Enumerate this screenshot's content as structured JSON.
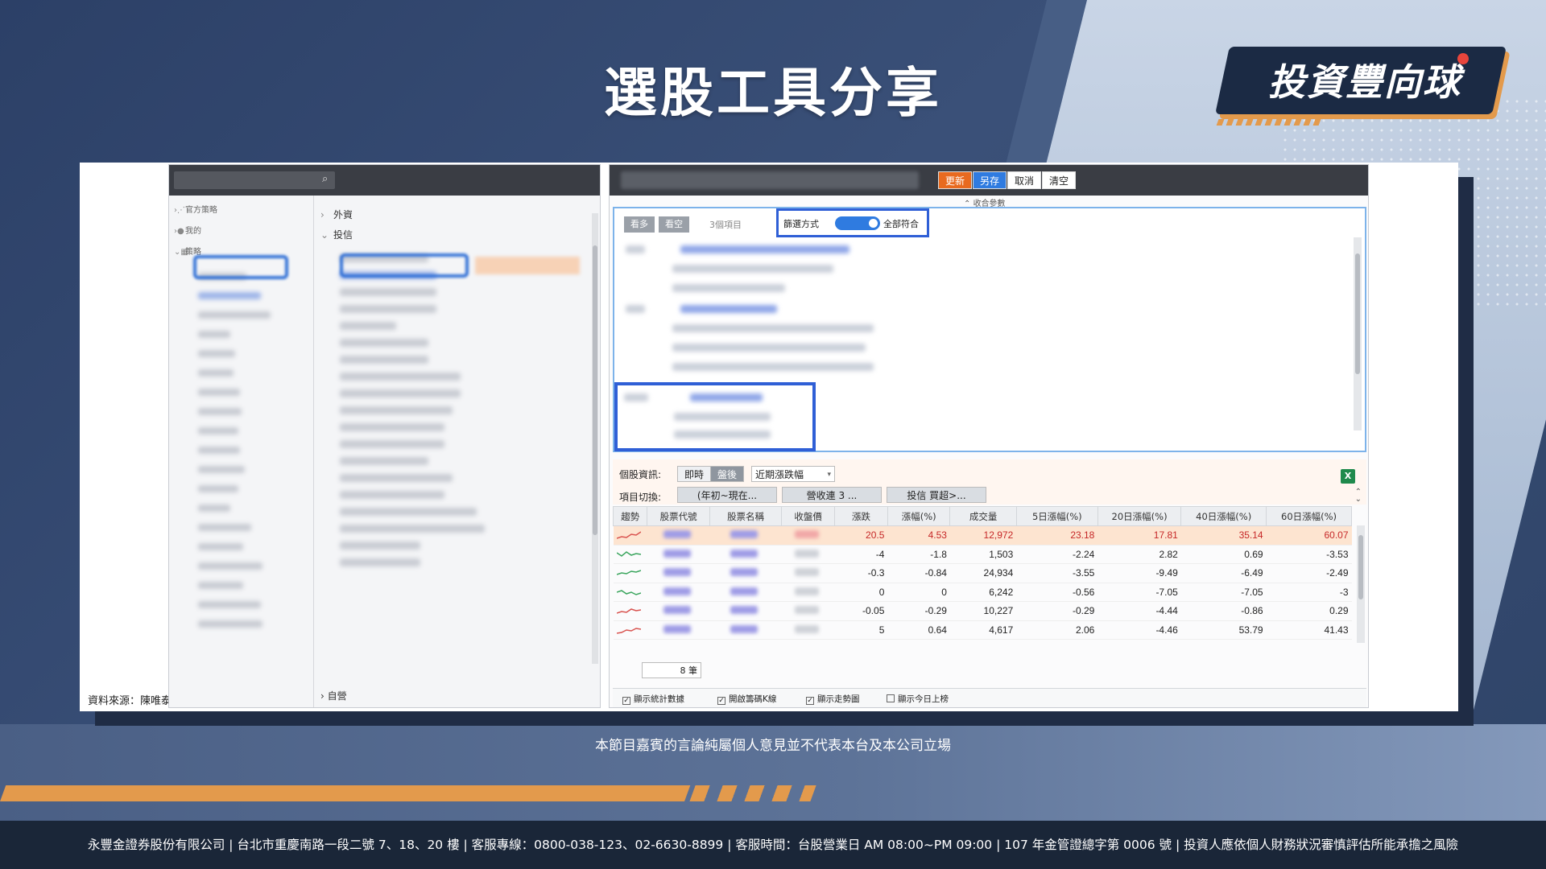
{
  "slide": {
    "title": "選股工具分享",
    "logo_text": "投資豐向球",
    "source": "資料來源：陳唯泰 提供",
    "disclaimer": "本節目嘉賓的言論純屬個人意見並不代表本台及本公司立場",
    "footer": "永豐金證券股份有限公司 | 台北市重慶南路一段二號 7、18、20 樓 | 客服專線：0800-038-123、02-6630-8899 | 客服時間：台股營業日 AM 08:00~PM 09:00 | 107 年金管證總字第 0006 號 | 投資人應依個人財務狀況審慎評估所能承擔之風險"
  },
  "left_panel": {
    "tree": [
      {
        "icon": "share-icon",
        "label": "官方策略"
      },
      {
        "icon": "user-icon",
        "label": "我的"
      },
      {
        "icon": "grid-icon",
        "label": "策略"
      }
    ],
    "groups": [
      "外資",
      "投信"
    ],
    "bottom_group": "自營"
  },
  "right_panel": {
    "buttons": {
      "update": "更新",
      "save_as": "另存",
      "cancel": "取消",
      "clear": "清空"
    },
    "collapse_label": "收合參數",
    "pills": [
      "看多",
      "看空"
    ],
    "item_count": "3個項目",
    "filter_label": "篩選方式",
    "filter_value": "全部符合",
    "info": {
      "label": "個股資訊:",
      "seg_realtime": "即時",
      "seg_after": "盤後",
      "dropdown": "近期漲跌幅",
      "switch_label": "項目切換:",
      "switch_buttons": [
        "(年初~現在...",
        "營收連 3 ...",
        "投信 買超>..."
      ]
    },
    "table": {
      "headers": [
        "趨勢",
        "股票代號",
        "股票名稱",
        "收盤價",
        "漲跌",
        "漲幅(%)",
        "成交量",
        "5日漲幅(%)",
        "20日漲幅(%)",
        "40日漲幅(%)",
        "60日漲幅(%)"
      ],
      "rows": [
        {
          "change": "20.5",
          "pct": "4.53",
          "volume": "12,972",
          "d5": "23.18",
          "d20": "17.81",
          "d40": "35.14",
          "d60": "60.07"
        },
        {
          "change": "-4",
          "pct": "-1.8",
          "volume": "1,503",
          "d5": "-2.24",
          "d20": "2.82",
          "d40": "0.69",
          "d60": "-3.53"
        },
        {
          "change": "-0.3",
          "pct": "-0.84",
          "volume": "24,934",
          "d5": "-3.55",
          "d20": "-9.49",
          "d40": "-6.49",
          "d60": "-2.49"
        },
        {
          "change": "0",
          "pct": "0",
          "volume": "6,242",
          "d5": "-0.56",
          "d20": "-7.05",
          "d40": "-7.05",
          "d60": "-3"
        },
        {
          "change": "-0.05",
          "pct": "-0.29",
          "volume": "10,227",
          "d5": "-0.29",
          "d20": "-4.44",
          "d40": "-0.86",
          "d60": "0.29"
        },
        {
          "change": "5",
          "pct": "0.64",
          "volume": "4,617",
          "d5": "2.06",
          "d20": "-4.46",
          "d40": "53.79",
          "d60": "41.43"
        }
      ]
    },
    "total": "8 筆",
    "options": [
      "顯示統計數據",
      "開啟籌碼K線",
      "顯示走勢圖",
      "顯示今日上榜"
    ]
  },
  "colors": {
    "accent_orange": "#e39a4c",
    "brand_dark": "#1b2a44",
    "highlight_blue": "#2f5fd6",
    "up_red": "#c62828"
  }
}
